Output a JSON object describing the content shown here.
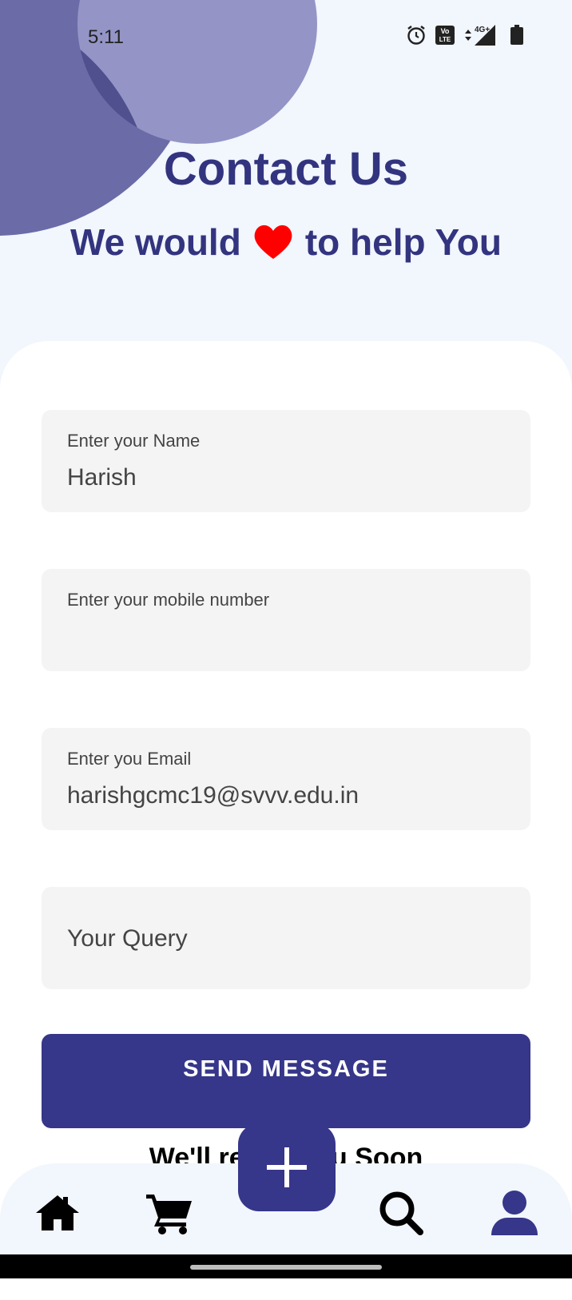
{
  "status_bar": {
    "time": "5:11",
    "icons": [
      "alarm-icon",
      "volte-icon",
      "signal-4g-icon",
      "battery-icon"
    ],
    "network_label": "4G+",
    "volte_label": "Vo LTE"
  },
  "header": {
    "title": "Contact Us",
    "subtitle_before": "We would",
    "subtitle_icon": "heart-icon",
    "subtitle_after": "to help You"
  },
  "form": {
    "name_label": "Enter your Name",
    "name_value": "Harish",
    "mobile_label": "Enter your mobile number",
    "mobile_value": "",
    "email_label": "Enter you Email",
    "email_value": "harishgcmc19@svvv.edu.in",
    "query_placeholder": "Your Query",
    "send_label": "SEND MESSAGE"
  },
  "footer_text": "We'll reach You Soon",
  "bottom_nav": {
    "items": [
      "home-icon",
      "cart-icon",
      "add-icon",
      "search-icon",
      "profile-icon"
    ]
  },
  "colors": {
    "primary": "#36368a",
    "title": "#33347f",
    "heart": "#ff0000",
    "background": "#f2f6fd"
  }
}
